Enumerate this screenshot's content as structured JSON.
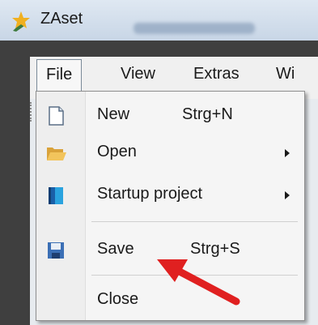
{
  "window": {
    "title": "ZAset"
  },
  "menubar": {
    "items": [
      {
        "label": "File"
      },
      {
        "label": "View"
      },
      {
        "label": "Extras"
      },
      {
        "label": "Wi"
      }
    ]
  },
  "file_menu": {
    "items": [
      {
        "label": "New",
        "shortcut": "Strg+N",
        "icon": "new-document-icon"
      },
      {
        "label": "Open",
        "shortcut": "",
        "icon": "open-folder-icon",
        "submenu": true
      },
      {
        "label": "Startup project",
        "shortcut": "",
        "icon": "startup-project-icon",
        "submenu": true
      },
      {
        "label": "Save",
        "shortcut": "Strg+S",
        "icon": "save-icon"
      },
      {
        "label": "Close",
        "shortcut": ""
      }
    ]
  },
  "colors": {
    "annotation_arrow": "#e02020",
    "menu_bg": "#f5f5f5"
  }
}
